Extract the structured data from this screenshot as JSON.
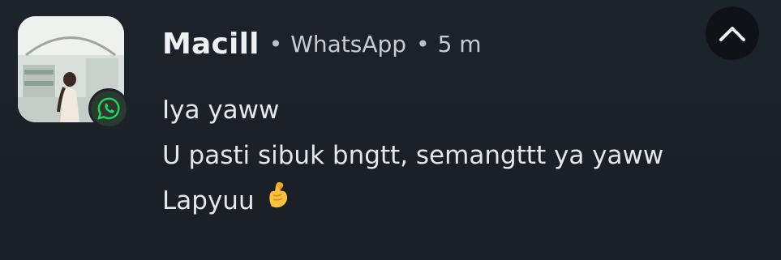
{
  "notification": {
    "sender": "Macill",
    "separator": "•",
    "app_name": "WhatsApp",
    "time_ago": "5 m",
    "messages": [
      "Iya yaww",
      "U pasti sibuk bngtt, semangttt ya yaww",
      "Lapyuu"
    ],
    "trailing_emoji": "crossed-fingers-heart-emoji",
    "avatar": "contact-photo",
    "app_icon": "whatsapp-icon",
    "collapse_icon": "chevron-up-icon"
  },
  "colors": {
    "background": "#1b2026",
    "text_primary": "#eef1f4",
    "text_secondary": "#c7ccd2",
    "whatsapp_green": "#25d366",
    "button_bg": "#0f1216"
  }
}
